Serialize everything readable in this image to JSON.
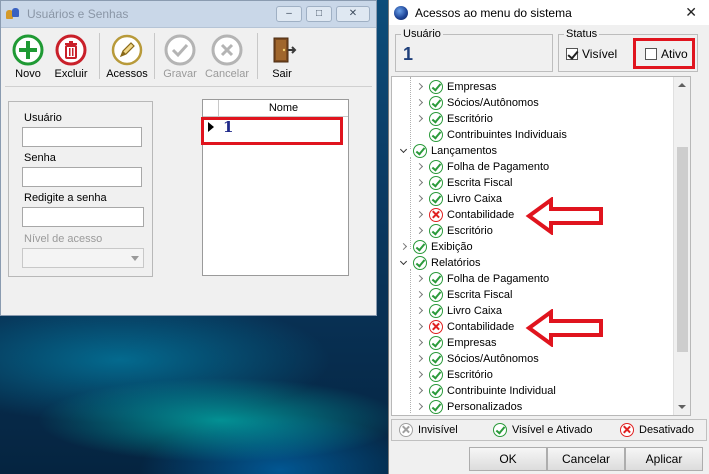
{
  "left_window": {
    "title": "Usuários e Senhas",
    "window_controls": {
      "minimize": "–",
      "restore": "□",
      "close": "✕"
    },
    "toolbar": {
      "novo": "Novo",
      "excluir": "Excluir",
      "acessos": "Acessos",
      "gravar": "Gravar",
      "cancelar": "Cancelar",
      "sair": "Sair"
    },
    "form": {
      "usuario_label": "Usuário",
      "usuario_value": "",
      "senha_label": "Senha",
      "senha_value": "",
      "redigite_label": "Redigite a senha",
      "redigite_value": "",
      "nivel_label": "Nível de acesso",
      "nivel_value": ""
    },
    "grid": {
      "column": "Nome",
      "rows": [
        "1"
      ]
    }
  },
  "right_window": {
    "title": "Acessos ao menu do sistema",
    "close": "✕",
    "usuario_group_label": "Usuário",
    "usuario_value": "1",
    "status_group_label": "Status",
    "visivel_label": "Visível",
    "visivel_checked": true,
    "ativo_label": "Ativo",
    "ativo_checked": false,
    "tree": [
      {
        "label": "Empresas",
        "level": 1,
        "status": "ok"
      },
      {
        "label": "Sócios/Autônomos",
        "level": 1,
        "status": "ok"
      },
      {
        "label": "Escritório",
        "level": 1,
        "status": "ok"
      },
      {
        "label": "Contribuintes Individuais",
        "level": 1,
        "status": "ok",
        "leaf": true
      },
      {
        "label": "Lançamentos",
        "level": 0,
        "status": "ok",
        "open": true
      },
      {
        "label": "Folha de Pagamento",
        "level": 1,
        "status": "ok"
      },
      {
        "label": "Escrita Fiscal",
        "level": 1,
        "status": "ok"
      },
      {
        "label": "Livro Caixa",
        "level": 1,
        "status": "ok"
      },
      {
        "label": "Contabilidade",
        "level": 1,
        "status": "no"
      },
      {
        "label": "Escritório",
        "level": 1,
        "status": "ok"
      },
      {
        "label": "Exibição",
        "level": 0,
        "status": "ok"
      },
      {
        "label": "Relatórios",
        "level": 0,
        "status": "ok",
        "open": true
      },
      {
        "label": "Folha de Pagamento",
        "level": 1,
        "status": "ok"
      },
      {
        "label": "Escrita Fiscal",
        "level": 1,
        "status": "ok"
      },
      {
        "label": "Livro Caixa",
        "level": 1,
        "status": "ok"
      },
      {
        "label": "Contabilidade",
        "level": 1,
        "status": "no"
      },
      {
        "label": "Empresas",
        "level": 1,
        "status": "ok"
      },
      {
        "label": "Sócios/Autônomos",
        "level": 1,
        "status": "ok"
      },
      {
        "label": "Escritório",
        "level": 1,
        "status": "ok"
      },
      {
        "label": "Contribuinte Individual",
        "level": 1,
        "status": "ok"
      },
      {
        "label": "Personalizados",
        "level": 1,
        "status": "ok"
      }
    ],
    "legend": {
      "invisivel": "Invisível",
      "visivel_ativado": "Visível e Ativado",
      "desativado": "Desativado"
    },
    "buttons": {
      "ok": "OK",
      "cancelar": "Cancelar",
      "aplicar": "Aplicar"
    }
  },
  "colors": {
    "highlight_red": "#e0141e",
    "status_green": "#2a9a3a",
    "status_red": "#e02020"
  }
}
